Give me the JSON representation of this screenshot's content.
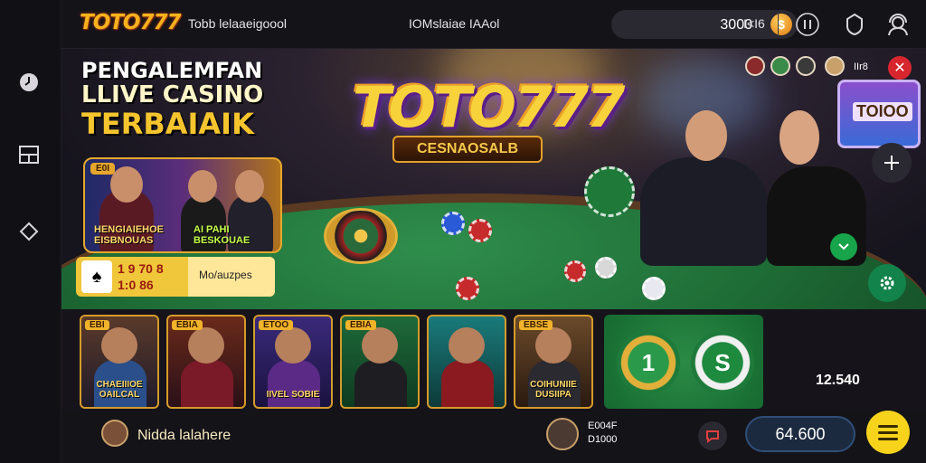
{
  "rail": {
    "items": [
      {
        "icon": "clock-icon"
      },
      {
        "icon": "layout-icon"
      },
      {
        "icon": "diamond-icon"
      }
    ]
  },
  "header": {
    "logo": "TOTO777",
    "nav": [
      "Tobb lelaaeigoool",
      "IOMslaiae IAAol"
    ],
    "balance": "3000",
    "coin_symbol": "$",
    "balance_suffix": "I<I6",
    "icons": [
      "bar-chart-icon",
      "shield-icon",
      "user-support-icon"
    ]
  },
  "hero": {
    "title_lines": [
      "PENGALEMFAN",
      "LLIVE CASINO",
      "TERBAIAIK"
    ],
    "logo": "TOTO777",
    "sublogo": "CESNAOSALB",
    "promo": {
      "tag": "E0I",
      "name": "HENGIAIEHOE EISBNOUAS",
      "name2": "AI PAHI BESKOUAE"
    },
    "odds": {
      "line1": "1 9 70 8",
      "line2": "1:0 86",
      "label": "Mo/auzpes"
    },
    "online_count": "IIr8",
    "close_symbol": "✕",
    "screen_text": "TOIOO"
  },
  "games": [
    {
      "tag": "EBI",
      "name": "CHAEIIIOE OAILCAL",
      "body": "#2a4f8a"
    },
    {
      "tag": "EBIA",
      "name": "",
      "body": "#7a1a28"
    },
    {
      "tag": "ETOO",
      "name": "IIVEL SOBIE",
      "body": "#5b2a86"
    },
    {
      "tag": "EBIA",
      "name": "",
      "body": "#1e1e22"
    },
    {
      "tag": "",
      "name": "",
      "body": "#8a1a20"
    },
    {
      "tag": "EBSE",
      "name": "COIHUNIIE DUSIIPA",
      "body": "#2a2a30"
    }
  ],
  "chips": [
    {
      "label": "1",
      "color": "#1e8a3e"
    },
    {
      "label": "S",
      "color": "#1e8a3e"
    }
  ],
  "strip_number": "12.540",
  "footer": {
    "username": "Nidda lalahere",
    "dealer_l1": "E004F",
    "dealer_l2": "D1000",
    "total": "64.600"
  },
  "colors": {
    "accent": "#f7d31c",
    "table": "#1f6e37",
    "gold": "#e6a72c"
  }
}
